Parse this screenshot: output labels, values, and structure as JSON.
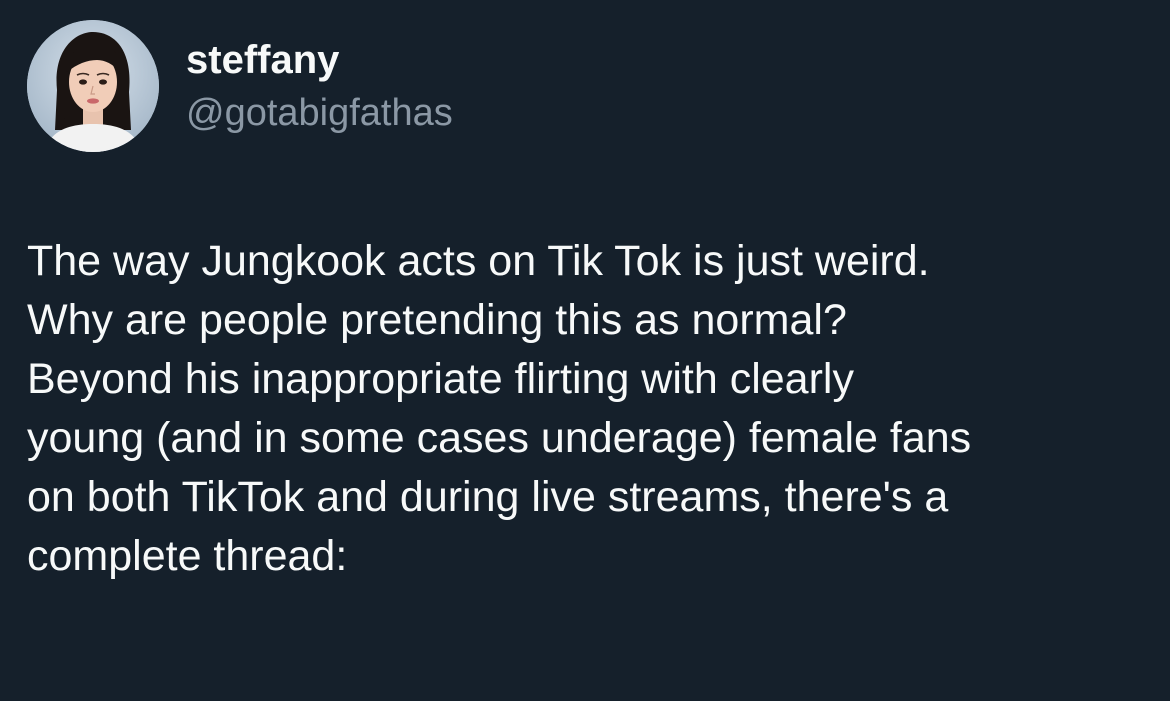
{
  "author": {
    "avatar_icon": "profile-photo-icon",
    "display_name": "steffany",
    "handle": "@gotabigfathas"
  },
  "tweet": {
    "lines": [
      "The way Jungkook acts on Tik Tok is just weird.",
      "Why are people pretending this as normal?",
      "Beyond his inappropriate flirting with clearly",
      "young (and in some cases underage) female fans",
      "on both TikTok and during live streams, there's a",
      "complete thread:"
    ]
  },
  "colors": {
    "background": "#15202b",
    "primary_text": "#f7f9f9",
    "secondary_text": "#8b98a5"
  }
}
